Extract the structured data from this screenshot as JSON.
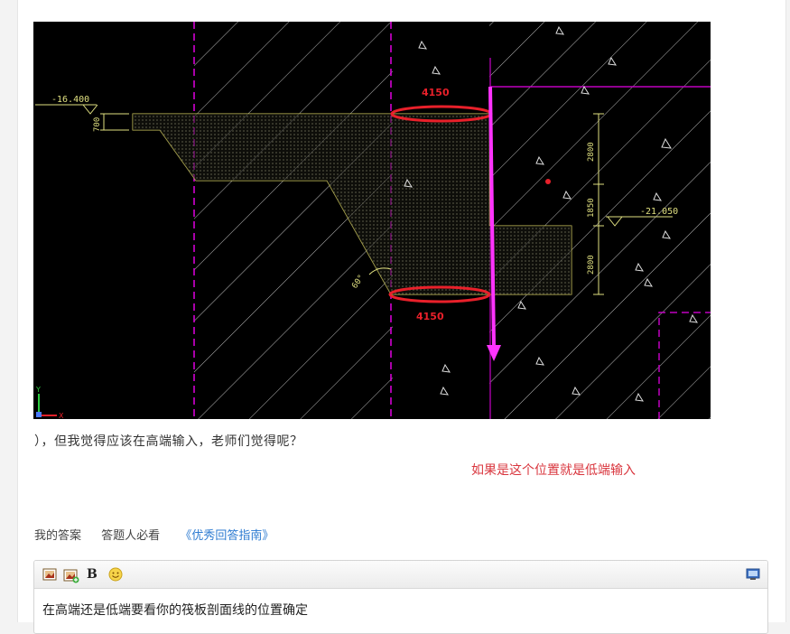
{
  "figure": {
    "labels": {
      "elev_left": "-16.400",
      "elev_right": "-21.050",
      "dim_700": "700",
      "dim_2800_top": "2800",
      "dim_1850": "1850",
      "dim_2800_bottom": "2800",
      "angle": "60°",
      "top_annotation": "4150",
      "bottom_annotation": "4150",
      "axis_y": "Y",
      "axis_x": "X"
    },
    "colors": {
      "background": "#000000",
      "hatch": "#ffffff",
      "slab_outline": "#c8c25a",
      "magenta": "#e100e1",
      "arrow": "#ff33ff",
      "highlight": "#e8202a",
      "dim_lines": "#e0e080"
    }
  },
  "question": {
    "text": "），但我觉得应该在高端输入，老师们觉得呢？"
  },
  "annotation": {
    "text": "如果是这个位置就是低端输入"
  },
  "tabs": {
    "my_answer": "我的答案",
    "must_read": "答题人必看",
    "guide_link": "《优秀回答指南》"
  },
  "editor": {
    "toolbar": {
      "image_icon": "image-icon",
      "image_upload_icon": "image-upload-icon",
      "bold_label": "B",
      "emoji_icon": "smiley-icon",
      "fullscreen_icon": "monitor-icon"
    },
    "content": "在高端还是低端要看你的筏板剖面线的位置确定"
  }
}
